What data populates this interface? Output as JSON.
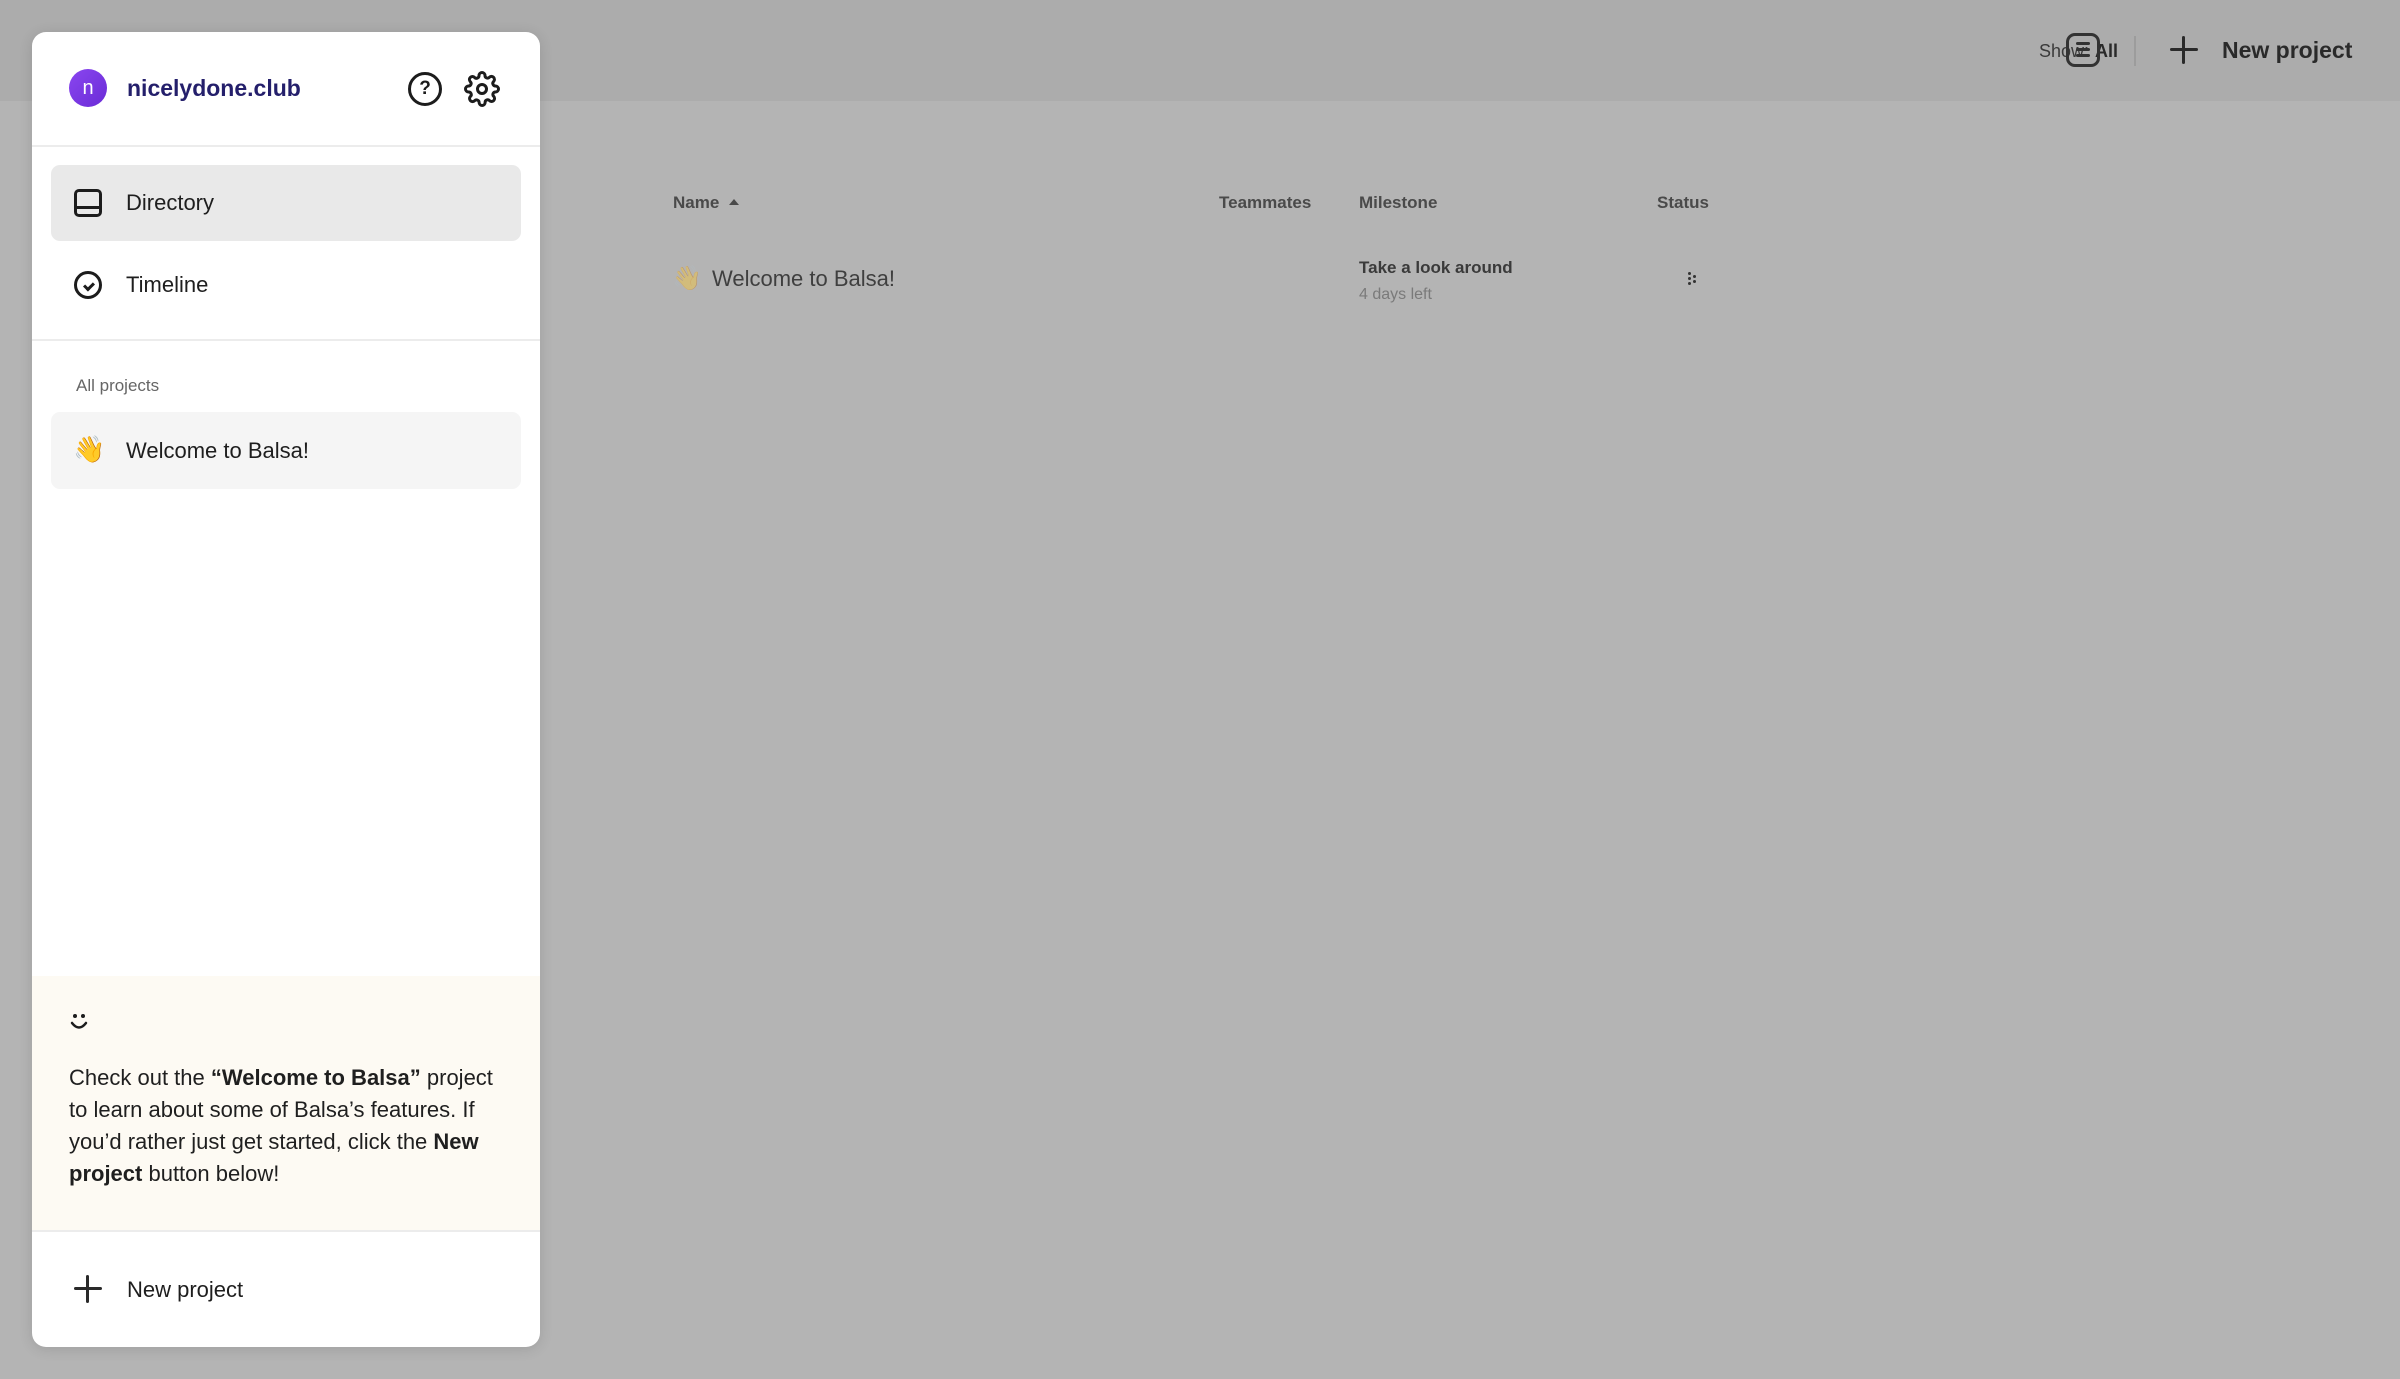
{
  "header": {
    "show_label": "Show:",
    "show_value": "All",
    "list_view_icon": "list-view-icon",
    "new_project_label": "New project"
  },
  "table": {
    "columns": [
      "Name",
      "Teammates",
      "Milestone",
      "Status"
    ],
    "rows": [
      {
        "icon": "👋",
        "name": "Welcome to Balsa!",
        "milestone_title": "Take a look around",
        "milestone_sub": "4 days left",
        "status_icon": "status-dots-icon"
      }
    ]
  },
  "sidebar": {
    "avatar_letter": "n",
    "org_name": "nicelydone.club",
    "help_icon": "help-icon",
    "settings_icon": "gear-icon",
    "help_glyph": "?",
    "nav": [
      {
        "label": "Directory",
        "icon": "directory-icon",
        "active": true
      },
      {
        "label": "Timeline",
        "icon": "timeline-icon",
        "active": false
      }
    ],
    "section_label": "All projects",
    "projects": [
      {
        "icon": "👋",
        "label": "Welcome to Balsa!"
      }
    ],
    "tip": {
      "t1": "Check out the ",
      "t2": "“Welcome to Balsa”",
      "t3": " project to learn about some of Balsa’s features. If you’d rather just get started, click the ",
      "t4": "New project",
      "t5": " button below!"
    },
    "new_project_label": "New project"
  },
  "colors": {
    "avatar": "#7a38e6",
    "org_name": "#241f6b",
    "overlay": "#b4b4b4",
    "tip_background": "#fdfaf3"
  }
}
